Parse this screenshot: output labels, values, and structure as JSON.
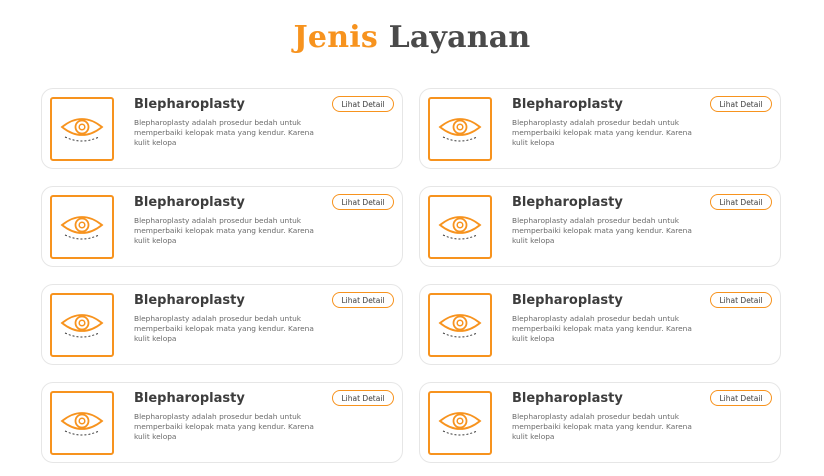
{
  "header": {
    "title_accent": "Jenis",
    "title_rest": "Layanan"
  },
  "cards": [
    {
      "title": "Blepharoplasty",
      "description": "Blepharoplasty adalah prosedur bedah untuk memperbaiki kelopak mata yang kendur. Karena kulit kelopa",
      "button": "Lihat Detail",
      "icon": "eye-icon"
    },
    {
      "title": "Blepharoplasty",
      "description": "Blepharoplasty adalah prosedur bedah untuk memperbaiki kelopak mata yang kendur. Karena kulit kelopa",
      "button": "Lihat Detail",
      "icon": "eye-icon"
    },
    {
      "title": "Blepharoplasty",
      "description": "Blepharoplasty adalah prosedur bedah untuk memperbaiki kelopak mata yang kendur. Karena kulit kelopa",
      "button": "Lihat Detail",
      "icon": "eye-icon"
    },
    {
      "title": "Blepharoplasty",
      "description": "Blepharoplasty adalah prosedur bedah untuk memperbaiki kelopak mata yang kendur. Karena kulit kelopa",
      "button": "Lihat Detail",
      "icon": "eye-icon"
    },
    {
      "title": "Blepharoplasty",
      "description": "Blepharoplasty adalah prosedur bedah untuk memperbaiki kelopak mata yang kendur. Karena kulit kelopa",
      "button": "Lihat Detail",
      "icon": "eye-icon"
    },
    {
      "title": "Blepharoplasty",
      "description": "Blepharoplasty adalah prosedur bedah untuk memperbaiki kelopak mata yang kendur. Karena kulit kelopa",
      "button": "Lihat Detail",
      "icon": "eye-icon"
    },
    {
      "title": "Blepharoplasty",
      "description": "Blepharoplasty adalah prosedur bedah untuk memperbaiki kelopak mata yang kendur. Karena kulit kelopa",
      "button": "Lihat Detail",
      "icon": "eye-icon"
    },
    {
      "title": "Blepharoplasty",
      "description": "Blepharoplasty adalah prosedur bedah untuk memperbaiki kelopak mata yang kendur. Karena kulit kelopa",
      "button": "Lihat Detail",
      "icon": "eye-icon"
    }
  ],
  "colors": {
    "accent": "#f7931e",
    "text": "#3d3d3d"
  }
}
